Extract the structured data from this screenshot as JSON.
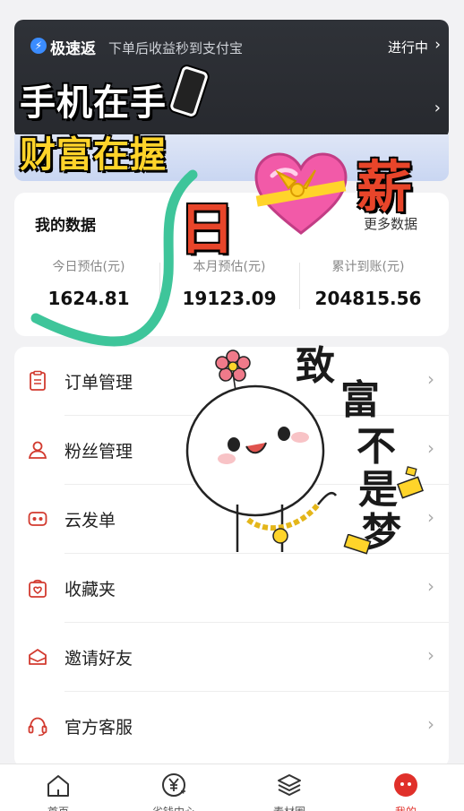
{
  "banner": {
    "title": "极速返",
    "subtitle": "下单后收益秒到支付宝",
    "status": "进行中",
    "chevron": "›"
  },
  "stickers": {
    "line1": "手机在手",
    "line2": "财富在握",
    "ri": "日",
    "xin": "薪",
    "zhi": "致",
    "fu": "富",
    "bu": "不",
    "shi": "是",
    "meng": "梦"
  },
  "data_card": {
    "title": "我的数据",
    "more": "更多数据",
    "stats": [
      {
        "label": "今日预估(元)",
        "value": "1624.81"
      },
      {
        "label": "本月预估(元)",
        "value": "19123.09"
      },
      {
        "label": "累计到账(元)",
        "value": "204815.56"
      }
    ]
  },
  "menu": [
    {
      "label": "订单管理",
      "icon": "clipboard-icon"
    },
    {
      "label": "粉丝管理",
      "icon": "person-icon"
    },
    {
      "label": "云发单",
      "icon": "robot-icon"
    },
    {
      "label": "收藏夹",
      "icon": "bag-heart-icon"
    },
    {
      "label": "邀请好友",
      "icon": "envelope-icon"
    },
    {
      "label": "官方客服",
      "icon": "headset-icon"
    }
  ],
  "tabs": [
    {
      "label": "首页",
      "icon": "home-icon"
    },
    {
      "label": "省钱中心",
      "icon": "yen-icon"
    },
    {
      "label": "素材圈",
      "icon": "layers-icon"
    },
    {
      "label": "我的",
      "icon": "profile-icon",
      "active": true
    }
  ],
  "colors": {
    "accent": "#e0302a",
    "sticker_yellow": "#ffd42a",
    "green_check": "#3ec59a",
    "menu_icon": "#d23a2f"
  }
}
